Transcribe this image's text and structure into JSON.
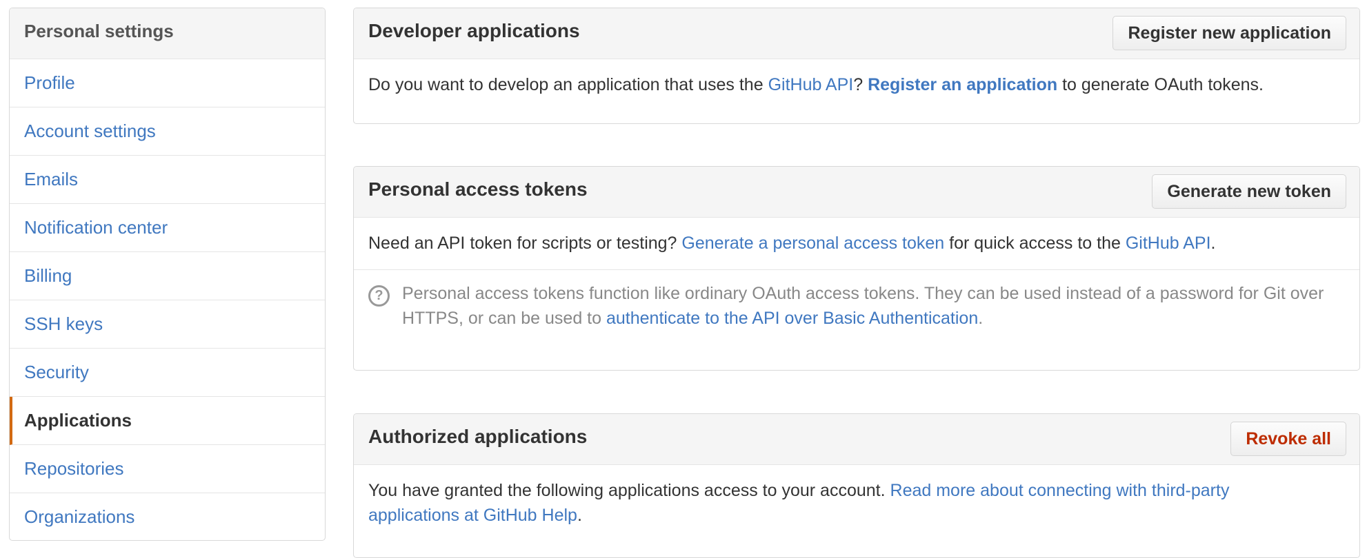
{
  "sidebar": {
    "title": "Personal settings",
    "items": [
      {
        "label": "Profile"
      },
      {
        "label": "Account settings"
      },
      {
        "label": "Emails"
      },
      {
        "label": "Notification center"
      },
      {
        "label": "Billing"
      },
      {
        "label": "SSH keys"
      },
      {
        "label": "Security"
      },
      {
        "label": "Applications",
        "selected": true
      },
      {
        "label": "Repositories"
      },
      {
        "label": "Organizations"
      }
    ]
  },
  "developer_apps": {
    "title": "Developer applications",
    "button": "Register new application",
    "text_1": "Do you want to develop an application that uses the ",
    "link_api": "GitHub API",
    "text_2": "? ",
    "link_register": "Register an application",
    "text_3": " to generate OAuth tokens."
  },
  "access_tokens": {
    "title": "Personal access tokens",
    "button": "Generate new token",
    "text_1": "Need an API token for scripts or testing? ",
    "link_generate": "Generate a personal access token",
    "text_2": " for quick access to the ",
    "link_api": "GitHub API",
    "text_3": ".",
    "note_icon": "question-circle-icon",
    "note_text": "Personal access tokens function like ordinary OAuth access tokens. They can be used instead of a password for Git over HTTPS, or can be used to ",
    "note_link": "authenticate to the API over Basic Authentication",
    "note_end": "."
  },
  "authorized_apps": {
    "title": "Authorized applications",
    "button": "Revoke all",
    "text_1": "You have granted the following applications access to your account. ",
    "link_help": "Read more about connecting with third-party applications at GitHub Help",
    "text_2": "."
  },
  "colors": {
    "link": "#4078c0",
    "selected_accent": "#d26911",
    "danger": "#bd2c00"
  }
}
